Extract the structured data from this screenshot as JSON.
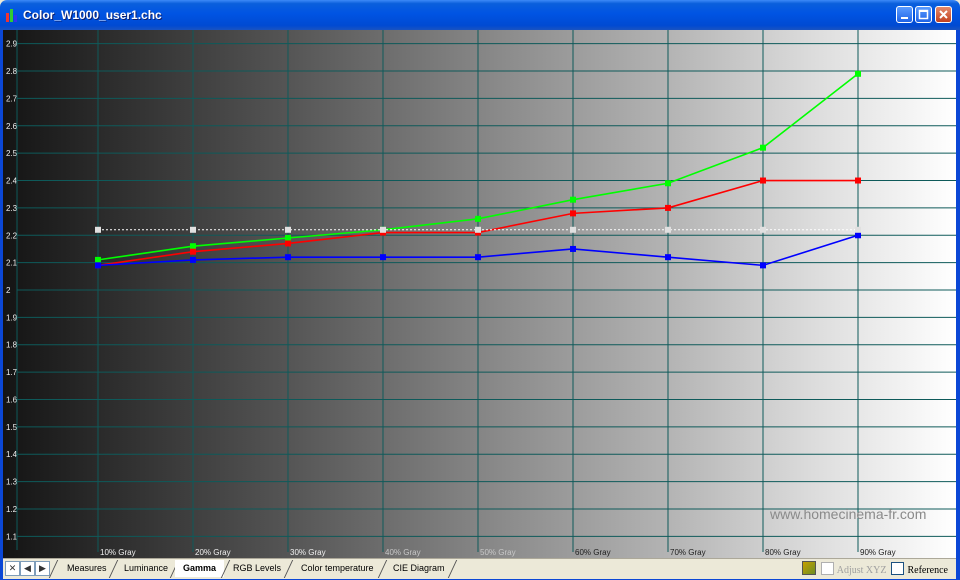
{
  "window": {
    "title": "Color_W1000_user1.chc"
  },
  "chart_data": {
    "type": "line",
    "title": "",
    "categories": [
      "10% Gray",
      "20% Gray",
      "30% Gray",
      "40% Gray",
      "50% Gray",
      "60% Gray",
      "70% Gray",
      "80% Gray",
      "90% Gray"
    ],
    "ylim": [
      1.05,
      2.95
    ],
    "yticks": [
      "2.9",
      "2.8",
      "2.7",
      "2.6",
      "2.5",
      "2.4",
      "2.3",
      "2.2",
      "2.1",
      "2",
      "1.9",
      "1.8",
      "1.7",
      "1.6",
      "1.5",
      "1.4",
      "1.3",
      "1.2",
      "1.1"
    ],
    "grid": true,
    "series": [
      {
        "color": "#00ff00",
        "values": [
          2.11,
          2.16,
          2.19,
          2.22,
          2.26,
          2.33,
          2.39,
          2.52,
          2.79
        ]
      },
      {
        "color": "#ff0000",
        "values": [
          2.09,
          2.14,
          2.17,
          2.21,
          2.21,
          2.28,
          2.3,
          2.4,
          2.4
        ]
      },
      {
        "color": "#0000ff",
        "values": [
          2.09,
          2.11,
          2.12,
          2.12,
          2.12,
          2.15,
          2.12,
          2.09,
          2.2
        ]
      },
      {
        "color": "#ffffff",
        "values": [
          2.22,
          2.22,
          2.22,
          2.22,
          2.22,
          2.22,
          2.22,
          2.22,
          2.22
        ],
        "dashed": true
      }
    ]
  },
  "watermark": "www.homecinema-fr.com",
  "tabs": [
    {
      "label": "Measures"
    },
    {
      "label": "Luminance"
    },
    {
      "label": "Gamma",
      "active": true
    },
    {
      "label": "RGB Levels"
    },
    {
      "label": "Color temperature"
    },
    {
      "label": "CIE Diagram"
    }
  ],
  "toolbar": {
    "adjust_xyz": "Adjust XYZ",
    "reference": "Reference"
  }
}
